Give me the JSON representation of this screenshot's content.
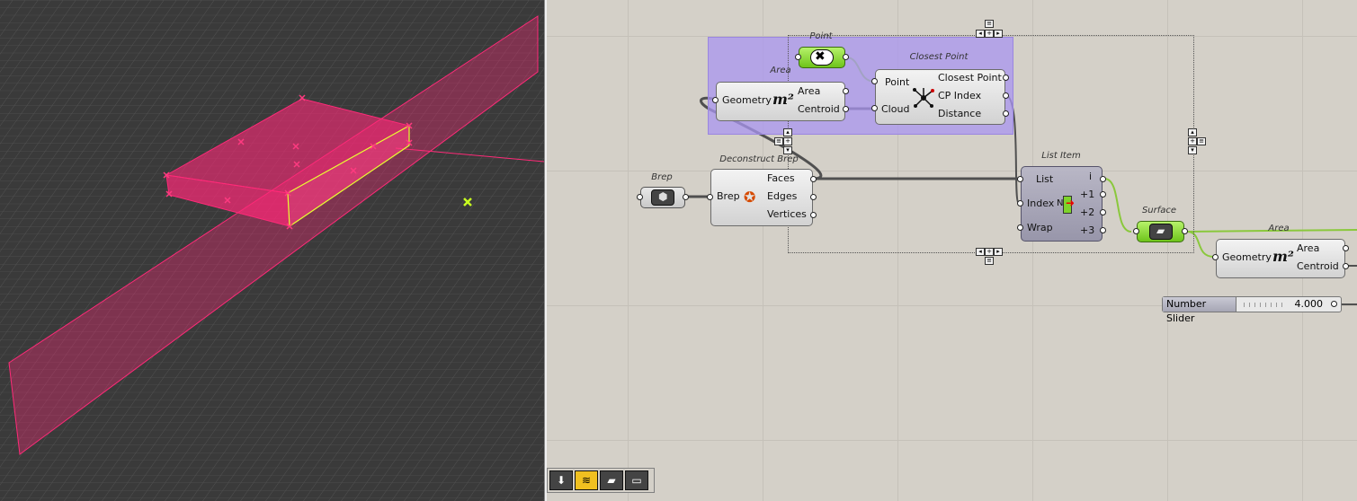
{
  "canvas": {
    "components": {
      "point_param": {
        "title": "Point"
      },
      "area_top": {
        "title": "Area",
        "inputs": [
          "Geometry"
        ],
        "outputs": [
          "Area",
          "Centroid"
        ],
        "icon_text": "m²"
      },
      "closest_point": {
        "title": "Closest Point",
        "inputs": [
          "Point",
          "Cloud"
        ],
        "outputs": [
          "Closest Point",
          "CP Index",
          "Distance"
        ]
      },
      "brep_param": {
        "title": "Brep"
      },
      "deconstruct_brep": {
        "title": "Deconstruct Brep",
        "inputs": [
          "Brep"
        ],
        "outputs": [
          "Faces",
          "Edges",
          "Vertices"
        ]
      },
      "list_item": {
        "title": "List Item",
        "inputs": [
          "List",
          "Index",
          "Wrap"
        ],
        "outputs": [
          "i",
          "+1",
          "+2",
          "+3"
        ],
        "index_flag": "N"
      },
      "surface_param": {
        "title": "Surface"
      },
      "area_bottom": {
        "title": "Area",
        "inputs": [
          "Geometry"
        ],
        "outputs": [
          "Area",
          "Centroid"
        ],
        "icon_text": "m²"
      }
    },
    "slider": {
      "name": "Number Slider",
      "value": "4.000"
    }
  },
  "toolbar": {
    "buttons": [
      "bake-icon",
      "preview-icon",
      "surface-icon",
      "slider-icon"
    ]
  },
  "colors": {
    "viewport_bg": "#3a3a3a",
    "selection_pink": "#ff2a78",
    "group_purple": "#aa96f0",
    "param_green": "#7ed32b",
    "wire": "#505050",
    "wire_green": "#8ac83c"
  }
}
